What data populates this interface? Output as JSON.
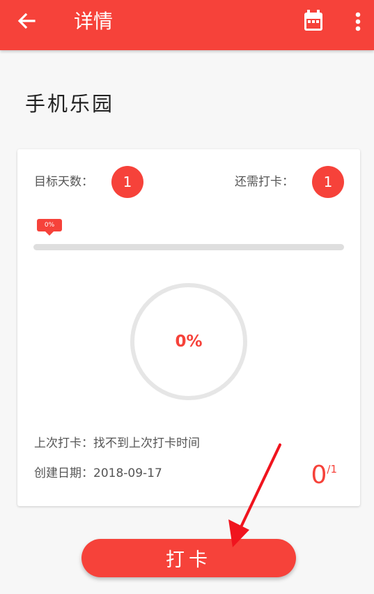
{
  "appbar": {
    "title": "详情",
    "back_icon": "arrow-left-icon",
    "calendar_icon": "calendar-icon",
    "more_icon": "more-vert-icon"
  },
  "project": {
    "name": "手机乐园"
  },
  "card": {
    "target_days_label": "目标天数：",
    "target_days_value": "1",
    "remaining_label": "还需打卡：",
    "remaining_value": "1",
    "progress_label": "0%",
    "progress_fraction": 0,
    "ring_text": "0%",
    "last_checkin_label": "上次打卡：找不到上次打卡时间",
    "created_label": "创建日期：2018-09-17",
    "count_done": "0",
    "count_total": "/1"
  },
  "checkin_button": {
    "label": "打卡"
  },
  "colors": {
    "accent": "#f6423a",
    "track": "#dedede",
    "annotation_arrow": "#f0141e"
  }
}
